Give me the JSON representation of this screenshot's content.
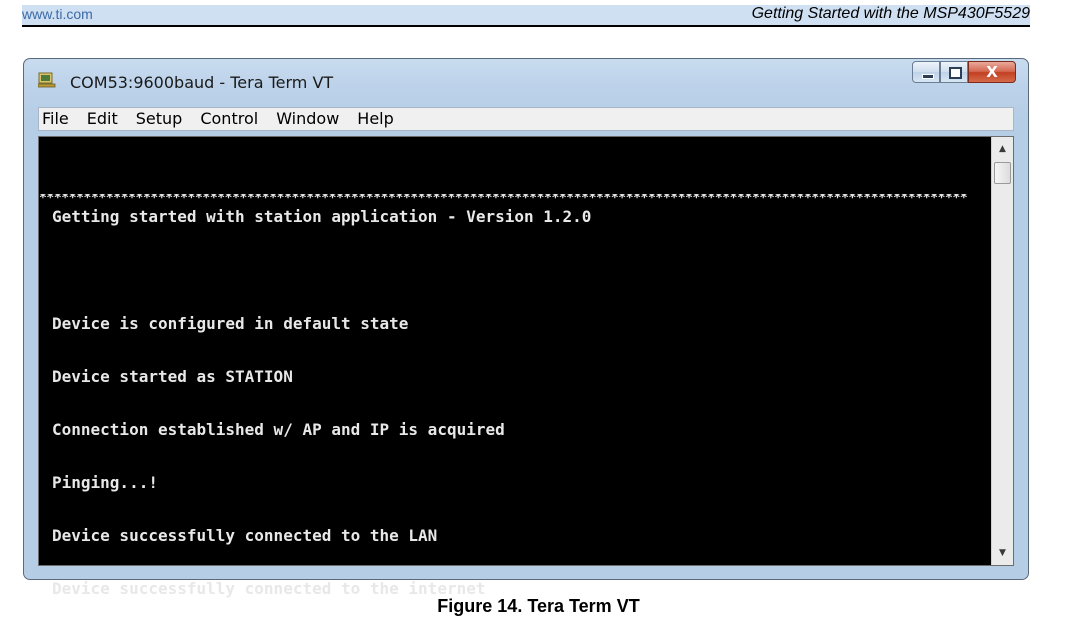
{
  "document": {
    "site": "www.ti.com",
    "title": "Getting Started with the MSP430F5529",
    "caption": "Figure 14. Tera Term VT"
  },
  "window": {
    "title": "COM53:9600baud - Tera Term VT",
    "close_glyph": "X",
    "icon": "tera-term-app-icon"
  },
  "menu": {
    "items": [
      "File",
      "Edit",
      "Setup",
      "Control",
      "Window",
      "Help"
    ]
  },
  "terminal": {
    "header": "Getting started with station application - Version 1.2.0",
    "separator": "*****************************************************************************************************************************",
    "lines": [
      "Device is configured in default state",
      "Device started as STATION",
      "Connection established w/ AP and IP is acquired",
      "Pinging...!",
      "Device successfully connected to the LAN",
      "Device successfully connected to the internet"
    ]
  },
  "scrollbar": {
    "up_glyph": "▲",
    "down_glyph": "▼"
  },
  "colors": {
    "terminal_bg": "#000000",
    "terminal_fg": "#e8e8e8",
    "frame": "#bcd2ea",
    "close_button": "#c23f22"
  }
}
